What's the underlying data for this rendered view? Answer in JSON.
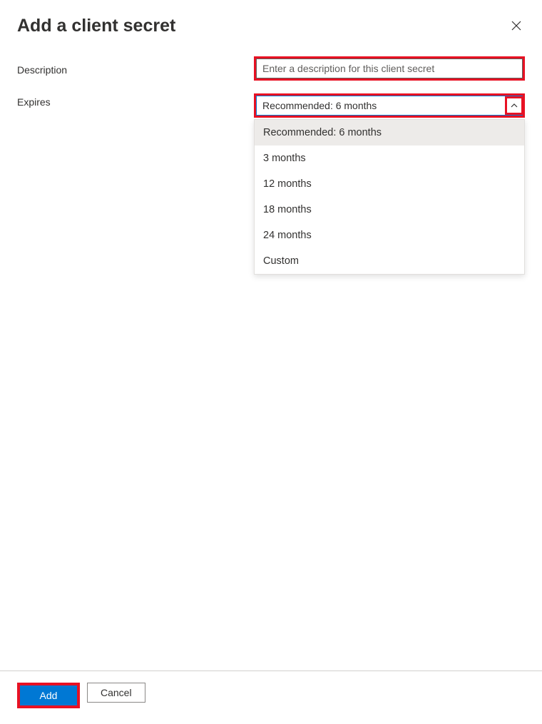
{
  "header": {
    "title": "Add a client secret"
  },
  "form": {
    "description": {
      "label": "Description",
      "placeholder": "Enter a description for this client secret",
      "value": ""
    },
    "expires": {
      "label": "Expires",
      "selected": "Recommended: 6 months",
      "options": [
        "Recommended: 6 months",
        "3 months",
        "12 months",
        "18 months",
        "24 months",
        "Custom"
      ]
    }
  },
  "footer": {
    "add_label": "Add",
    "cancel_label": "Cancel"
  }
}
